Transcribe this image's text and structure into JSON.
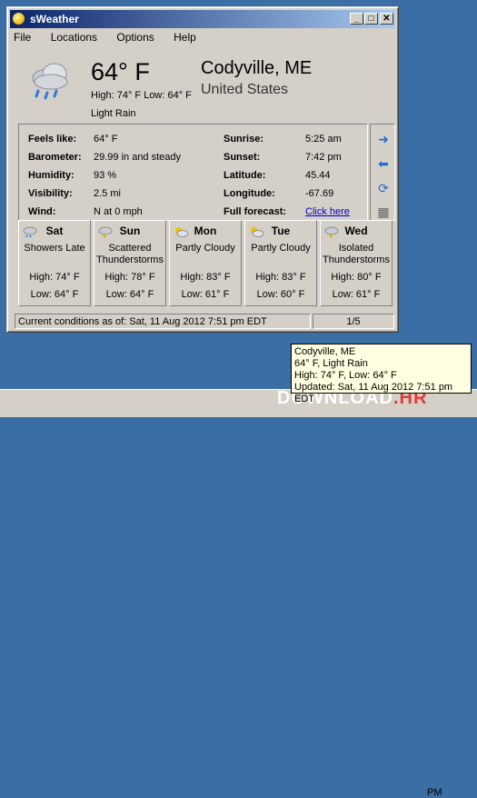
{
  "window": {
    "title": "sWeather",
    "buttons": {
      "minimize": "_",
      "maximize": "□",
      "close": "✕"
    }
  },
  "menu": [
    "File",
    "Locations",
    "Options",
    "Help"
  ],
  "current": {
    "temperature": "64° F",
    "high_low": "High: 74° F  Low: 64° F",
    "condition": "Light Rain",
    "city": "Codyville, ME",
    "country": "United States",
    "icon": "rain-cloud-icon"
  },
  "details": {
    "feels_like_label": "Feels like:",
    "feels_like": "64° F",
    "barometer_label": "Barometer:",
    "barometer": "29.99 in and steady",
    "humidity_label": "Humidity:",
    "humidity": "93 %",
    "visibility_label": "Visibility:",
    "visibility": "2.5 mi",
    "wind_label": "Wind:",
    "wind": "N at 0 mph",
    "sunrise_label": "Sunrise:",
    "sunrise": "5:25 am",
    "sunset_label": "Sunset:",
    "sunset": "7:42 pm",
    "latitude_label": "Latitude:",
    "latitude": "45.44",
    "longitude_label": "Longitude:",
    "longitude": "-67.69",
    "forecast_label": "Full forecast:",
    "forecast_link": "Click here"
  },
  "forecast": [
    {
      "day": "Sat",
      "condition": "Showers Late",
      "high": "High: 74° F",
      "low": "Low: 64° F",
      "icon": "showers-icon"
    },
    {
      "day": "Sun",
      "condition": "Scattered Thunderstorms",
      "high": "High: 78° F",
      "low": "Low: 64° F",
      "icon": "thunderstorm-icon"
    },
    {
      "day": "Mon",
      "condition": "Partly Cloudy",
      "high": "High: 83° F",
      "low": "Low: 61° F",
      "icon": "partly-cloudy-icon"
    },
    {
      "day": "Tue",
      "condition": "Partly Cloudy",
      "high": "High: 83° F",
      "low": "Low: 60° F",
      "icon": "partly-cloudy-icon"
    },
    {
      "day": "Wed",
      "condition": "Isolated Thunderstorms",
      "high": "High: 80° F",
      "low": "Low: 61° F",
      "icon": "thunderstorm-icon"
    }
  ],
  "status": {
    "conditions": "Current conditions as of: Sat, 11 Aug 2012 7:51 pm EDT",
    "page": "1/5"
  },
  "tooltip": {
    "line1": "Codyville, ME",
    "line2": "64° F, Light Rain",
    "line3": "High: 74° F, Low: 64° F",
    "line4": "Updated: Sat, 11 Aug 2012 7:51 pm EDT"
  },
  "watermark": {
    "left": "DOWNLOAD",
    "right": ".HR"
  },
  "tray": {
    "clock": "PM"
  },
  "colors": {
    "desktop": "#3a6ea5",
    "titlebar_start": "#0a246a",
    "titlebar_end": "#a6caf0",
    "link": "#0000cc",
    "tooltip_bg": "#ffffe1"
  }
}
